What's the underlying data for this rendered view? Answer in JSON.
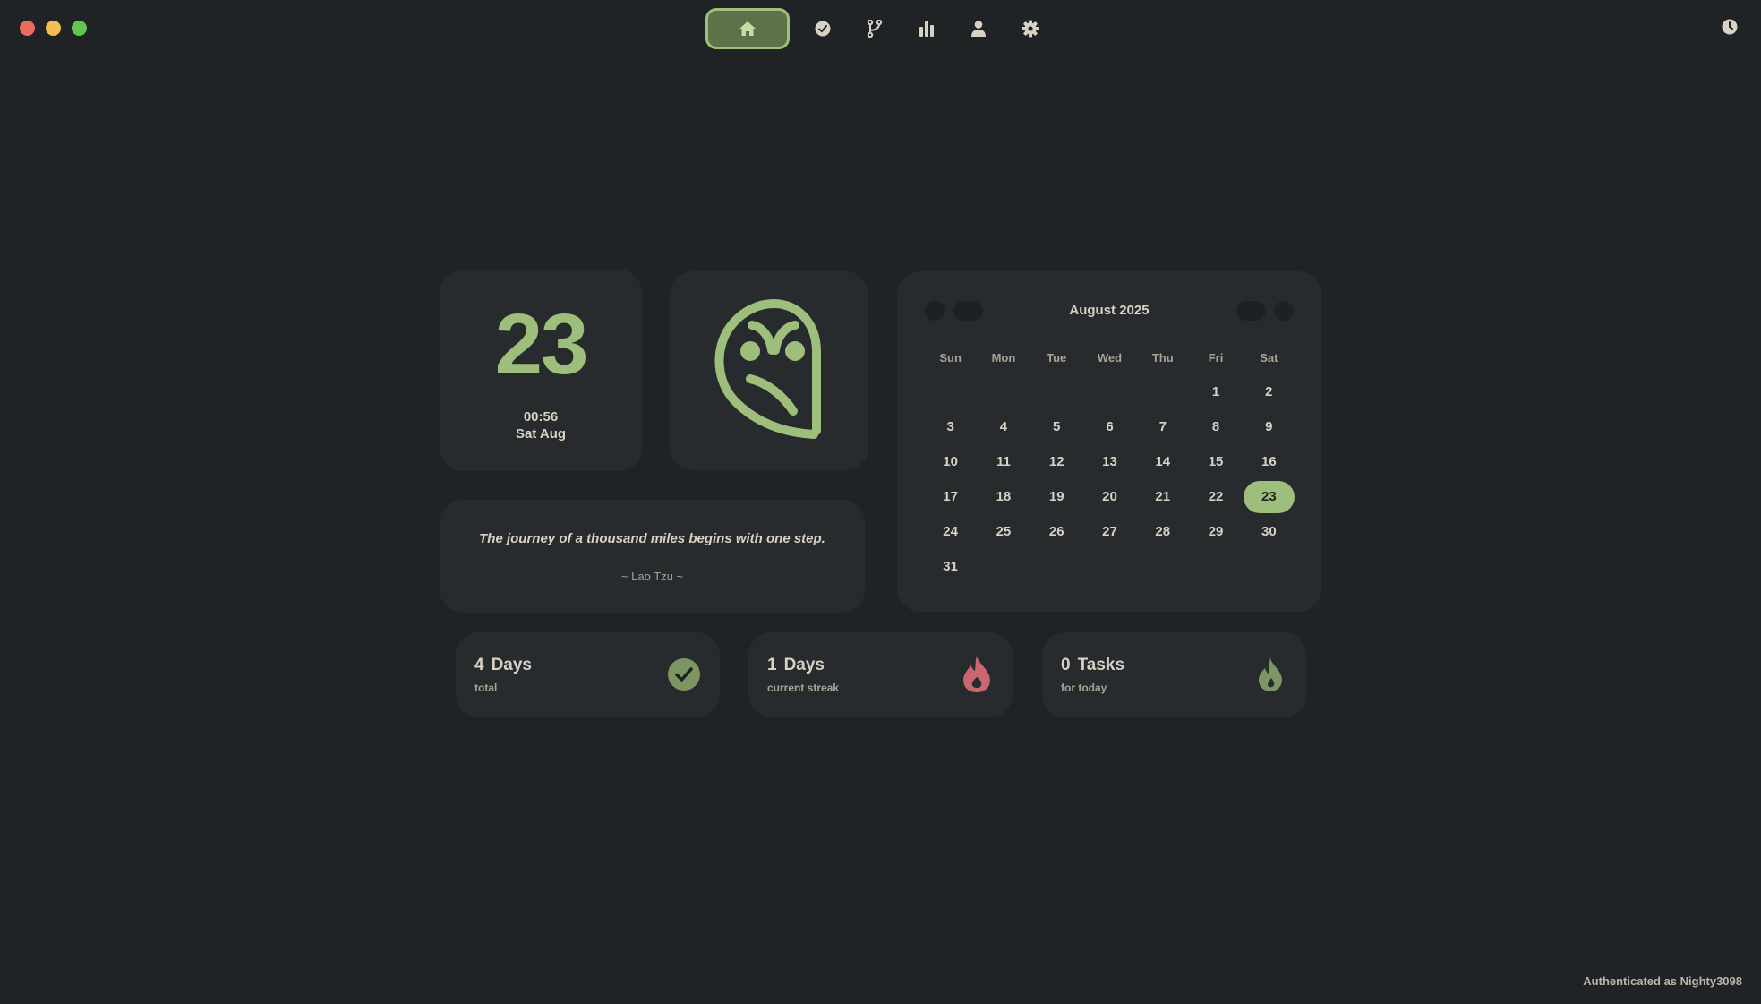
{
  "window": {
    "traffic_lights": [
      "close",
      "minimize",
      "zoom"
    ]
  },
  "nav": {
    "items": [
      {
        "icon": "home-icon",
        "active": true
      },
      {
        "icon": "check-circle-icon",
        "active": false
      },
      {
        "icon": "branch-icon",
        "active": false
      },
      {
        "icon": "bar-chart-icon",
        "active": false
      },
      {
        "icon": "user-icon",
        "active": false
      },
      {
        "icon": "gear-icon",
        "active": false
      }
    ],
    "history_icon": "clock-icon"
  },
  "date_card": {
    "day_number": "23",
    "time": "00:56",
    "weekday_month": "Sat Aug"
  },
  "logo_card": {
    "icon": "owl-logo-icon"
  },
  "quote": {
    "text": "The journey of a thousand miles begins with one step.",
    "author": "~ Lao Tzu ~"
  },
  "calendar": {
    "title": "August 2025",
    "weekdays": [
      "Sun",
      "Mon",
      "Tue",
      "Wed",
      "Thu",
      "Fri",
      "Sat"
    ],
    "weeks": [
      [
        "",
        "",
        "",
        "",
        "",
        "1",
        "2"
      ],
      [
        "3",
        "4",
        "5",
        "6",
        "7",
        "8",
        "9"
      ],
      [
        "10",
        "11",
        "12",
        "13",
        "14",
        "15",
        "16"
      ],
      [
        "17",
        "18",
        "19",
        "20",
        "21",
        "22",
        "23"
      ],
      [
        "24",
        "25",
        "26",
        "27",
        "28",
        "29",
        "30"
      ],
      [
        "31",
        "",
        "",
        "",
        "",
        "",
        ""
      ]
    ],
    "selected": "23"
  },
  "stats": [
    {
      "value": "4",
      "unit": "Days",
      "label": "total",
      "icon": "check-badge-icon",
      "color": "#7d9463"
    },
    {
      "value": "1",
      "unit": "Days",
      "label": "current streak",
      "icon": "flame-icon",
      "color": "#c9666f"
    },
    {
      "value": "0",
      "unit": "Tasks",
      "label": "for today",
      "icon": "droplet-flame-icon",
      "color": "#7d9463"
    }
  ],
  "footer": {
    "auth_text": "Authenticated as Nighty3098"
  },
  "colors": {
    "background": "#1f2326",
    "card": "#272b2e",
    "accent": "#9ebe7b",
    "text": "#d8d2c4",
    "muted": "#a9a396",
    "danger": "#c9666f"
  }
}
